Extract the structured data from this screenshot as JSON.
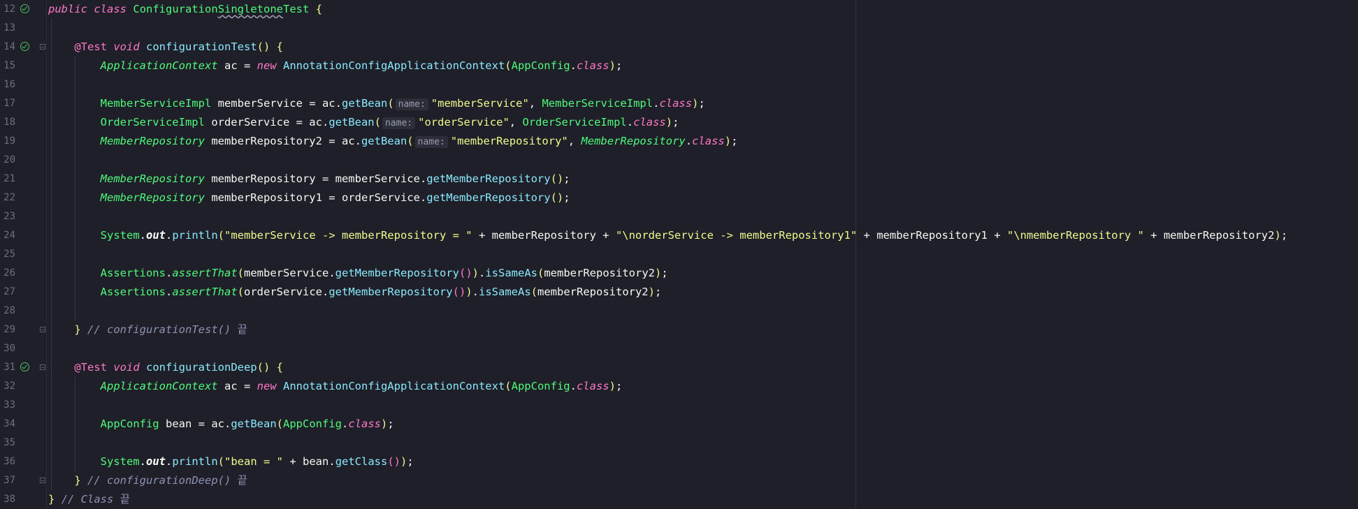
{
  "editor": {
    "lines": [
      {
        "n": "12",
        "run": true,
        "fold": false
      },
      {
        "n": "13",
        "run": false,
        "fold": false
      },
      {
        "n": "14",
        "run": true,
        "fold": true
      },
      {
        "n": "15",
        "run": false,
        "fold": false
      },
      {
        "n": "16",
        "run": false,
        "fold": false
      },
      {
        "n": "17",
        "run": false,
        "fold": false
      },
      {
        "n": "18",
        "run": false,
        "fold": false
      },
      {
        "n": "19",
        "run": false,
        "fold": false
      },
      {
        "n": "20",
        "run": false,
        "fold": false
      },
      {
        "n": "21",
        "run": false,
        "fold": false
      },
      {
        "n": "22",
        "run": false,
        "fold": false
      },
      {
        "n": "23",
        "run": false,
        "fold": false
      },
      {
        "n": "24",
        "run": false,
        "fold": false
      },
      {
        "n": "25",
        "run": false,
        "fold": false
      },
      {
        "n": "26",
        "run": false,
        "fold": false
      },
      {
        "n": "27",
        "run": false,
        "fold": false
      },
      {
        "n": "28",
        "run": false,
        "fold": false
      },
      {
        "n": "29",
        "run": false,
        "fold": true
      },
      {
        "n": "30",
        "run": false,
        "fold": false
      },
      {
        "n": "31",
        "run": true,
        "fold": true
      },
      {
        "n": "32",
        "run": false,
        "fold": false
      },
      {
        "n": "33",
        "run": false,
        "fold": false
      },
      {
        "n": "34",
        "run": false,
        "fold": false
      },
      {
        "n": "35",
        "run": false,
        "fold": false
      },
      {
        "n": "36",
        "run": false,
        "fold": false
      },
      {
        "n": "37",
        "run": false,
        "fold": true
      },
      {
        "n": "38",
        "run": false,
        "fold": false
      }
    ],
    "code": [
      {
        "tokens": [
          [
            "kw",
            "public"
          ],
          [
            "pun",
            " "
          ],
          [
            "kw",
            "class"
          ],
          [
            "pun",
            " "
          ],
          [
            "cls",
            "Configuration"
          ],
          [
            "cls under",
            "Singletone"
          ],
          [
            "cls",
            "Test"
          ],
          [
            "pun",
            " "
          ],
          [
            "par1",
            "{"
          ]
        ]
      },
      {
        "tokens": []
      },
      {
        "tokens": [
          [
            "pun",
            "    "
          ],
          [
            "ann",
            "@Test"
          ],
          [
            "pun",
            " "
          ],
          [
            "kw",
            "void"
          ],
          [
            "pun",
            " "
          ],
          [
            "mth",
            "configurationTest"
          ],
          [
            "par1",
            "()"
          ],
          [
            "pun",
            " "
          ],
          [
            "par1",
            "{"
          ]
        ]
      },
      {
        "tokens": [
          [
            "pun",
            "        "
          ],
          [
            "iface",
            "ApplicationContext"
          ],
          [
            "pun",
            " "
          ],
          [
            "var",
            "ac"
          ],
          [
            "pun",
            " = "
          ],
          [
            "kw",
            "new"
          ],
          [
            "pun",
            " "
          ],
          [
            "mth",
            "AnnotationConfigApplicationContext"
          ],
          [
            "par1",
            "("
          ],
          [
            "cls",
            "AppConfig"
          ],
          [
            "pun",
            "."
          ],
          [
            "kw",
            "class"
          ],
          [
            "par1",
            ")"
          ],
          [
            "pun",
            ";"
          ]
        ]
      },
      {
        "tokens": []
      },
      {
        "tokens": [
          [
            "pun",
            "        "
          ],
          [
            "cls",
            "MemberServiceImpl"
          ],
          [
            "pun",
            " "
          ],
          [
            "var",
            "memberService"
          ],
          [
            "pun",
            " = "
          ],
          [
            "var",
            "ac"
          ],
          [
            "pun",
            "."
          ],
          [
            "mth",
            "getBean"
          ],
          [
            "par1",
            "("
          ],
          [
            "hint",
            "name:"
          ],
          [
            "str",
            "\"memberService\""
          ],
          [
            "pun",
            ", "
          ],
          [
            "cls",
            "MemberServiceImpl"
          ],
          [
            "pun",
            "."
          ],
          [
            "kw",
            "class"
          ],
          [
            "par1",
            ")"
          ],
          [
            "pun",
            ";"
          ]
        ]
      },
      {
        "tokens": [
          [
            "pun",
            "        "
          ],
          [
            "cls",
            "OrderServiceImpl"
          ],
          [
            "pun",
            " "
          ],
          [
            "var",
            "orderService"
          ],
          [
            "pun",
            " = "
          ],
          [
            "var",
            "ac"
          ],
          [
            "pun",
            "."
          ],
          [
            "mth",
            "getBean"
          ],
          [
            "par1",
            "("
          ],
          [
            "hint",
            "name:"
          ],
          [
            "str",
            "\"orderService\""
          ],
          [
            "pun",
            ", "
          ],
          [
            "cls",
            "OrderServiceImpl"
          ],
          [
            "pun",
            "."
          ],
          [
            "kw",
            "class"
          ],
          [
            "par1",
            ")"
          ],
          [
            "pun",
            ";"
          ]
        ]
      },
      {
        "tokens": [
          [
            "pun",
            "        "
          ],
          [
            "iface",
            "MemberRepository"
          ],
          [
            "pun",
            " "
          ],
          [
            "var",
            "memberRepository2"
          ],
          [
            "pun",
            " = "
          ],
          [
            "var",
            "ac"
          ],
          [
            "pun",
            "."
          ],
          [
            "mth",
            "getBean"
          ],
          [
            "par1",
            "("
          ],
          [
            "hint",
            "name:"
          ],
          [
            "str",
            "\"memberRepository\""
          ],
          [
            "pun",
            ", "
          ],
          [
            "iface",
            "MemberRepository"
          ],
          [
            "pun",
            "."
          ],
          [
            "kw",
            "class"
          ],
          [
            "par1",
            ")"
          ],
          [
            "pun",
            ";"
          ]
        ]
      },
      {
        "tokens": []
      },
      {
        "tokens": [
          [
            "pun",
            "        "
          ],
          [
            "iface",
            "MemberRepository"
          ],
          [
            "pun",
            " "
          ],
          [
            "var",
            "memberRepository"
          ],
          [
            "pun",
            " = "
          ],
          [
            "var",
            "memberService"
          ],
          [
            "pun",
            "."
          ],
          [
            "mth",
            "getMemberRepository"
          ],
          [
            "par1",
            "()"
          ],
          [
            "pun",
            ";"
          ]
        ]
      },
      {
        "tokens": [
          [
            "pun",
            "        "
          ],
          [
            "iface",
            "MemberRepository"
          ],
          [
            "pun",
            " "
          ],
          [
            "var",
            "memberRepository1"
          ],
          [
            "pun",
            " = "
          ],
          [
            "var",
            "orderService"
          ],
          [
            "pun",
            "."
          ],
          [
            "mth",
            "getMemberRepository"
          ],
          [
            "par1",
            "()"
          ],
          [
            "pun",
            ";"
          ]
        ]
      },
      {
        "tokens": []
      },
      {
        "tokens": [
          [
            "pun",
            "        "
          ],
          [
            "cls",
            "System"
          ],
          [
            "pun",
            "."
          ],
          [
            "fld",
            "out"
          ],
          [
            "pun",
            "."
          ],
          [
            "mth",
            "println"
          ],
          [
            "par1",
            "("
          ],
          [
            "str",
            "\"memberService -> memberRepository = \""
          ],
          [
            "pun",
            " + "
          ],
          [
            "var",
            "memberRepository"
          ],
          [
            "pun",
            " + "
          ],
          [
            "str",
            "\"\\norderService -> memberRepository1\""
          ],
          [
            "pun",
            " + "
          ],
          [
            "var",
            "memberRepository1"
          ],
          [
            "pun",
            " + "
          ],
          [
            "str",
            "\"\\nmemberRepository \""
          ],
          [
            "pun",
            " + "
          ],
          [
            "var",
            "memberRepository2"
          ],
          [
            "par1",
            ")"
          ],
          [
            "pun",
            ";"
          ]
        ]
      },
      {
        "tokens": []
      },
      {
        "tokens": [
          [
            "pun",
            "        "
          ],
          [
            "cls",
            "Assertions"
          ],
          [
            "pun",
            "."
          ],
          [
            "stat",
            "assertThat"
          ],
          [
            "par1",
            "("
          ],
          [
            "var",
            "memberService"
          ],
          [
            "pun",
            "."
          ],
          [
            "mth",
            "getMemberRepository"
          ],
          [
            "par2",
            "()"
          ],
          [
            "par1",
            ")"
          ],
          [
            "pun",
            "."
          ],
          [
            "mth",
            "isSameAs"
          ],
          [
            "par1",
            "("
          ],
          [
            "var",
            "memberRepository2"
          ],
          [
            "par1",
            ")"
          ],
          [
            "pun",
            ";"
          ]
        ]
      },
      {
        "tokens": [
          [
            "pun",
            "        "
          ],
          [
            "cls",
            "Assertions"
          ],
          [
            "pun",
            "."
          ],
          [
            "stat",
            "assertThat"
          ],
          [
            "par1",
            "("
          ],
          [
            "var",
            "orderService"
          ],
          [
            "pun",
            "."
          ],
          [
            "mth",
            "getMemberRepository"
          ],
          [
            "par2",
            "()"
          ],
          [
            "par1",
            ")"
          ],
          [
            "pun",
            "."
          ],
          [
            "mth",
            "isSameAs"
          ],
          [
            "par1",
            "("
          ],
          [
            "var",
            "memberRepository2"
          ],
          [
            "par1",
            ")"
          ],
          [
            "pun",
            ";"
          ]
        ]
      },
      {
        "tokens": []
      },
      {
        "tokens": [
          [
            "pun",
            "    "
          ],
          [
            "par1",
            "}"
          ],
          [
            "pun",
            " "
          ],
          [
            "cmt",
            "// configurationTest() "
          ],
          [
            "kr",
            "끝"
          ]
        ]
      },
      {
        "tokens": []
      },
      {
        "tokens": [
          [
            "pun",
            "    "
          ],
          [
            "ann",
            "@Test"
          ],
          [
            "pun",
            " "
          ],
          [
            "kw",
            "void"
          ],
          [
            "pun",
            " "
          ],
          [
            "mth",
            "configurationDeep"
          ],
          [
            "par1",
            "()"
          ],
          [
            "pun",
            " "
          ],
          [
            "par1",
            "{"
          ]
        ]
      },
      {
        "tokens": [
          [
            "pun",
            "        "
          ],
          [
            "iface",
            "ApplicationContext"
          ],
          [
            "pun",
            " "
          ],
          [
            "var",
            "ac"
          ],
          [
            "pun",
            " = "
          ],
          [
            "kw",
            "new"
          ],
          [
            "pun",
            " "
          ],
          [
            "mth",
            "AnnotationConfigApplicationContext"
          ],
          [
            "par1",
            "("
          ],
          [
            "cls",
            "AppConfig"
          ],
          [
            "pun",
            "."
          ],
          [
            "kw",
            "class"
          ],
          [
            "par1",
            ")"
          ],
          [
            "pun",
            ";"
          ]
        ]
      },
      {
        "tokens": []
      },
      {
        "tokens": [
          [
            "pun",
            "        "
          ],
          [
            "cls",
            "AppConfig"
          ],
          [
            "pun",
            " "
          ],
          [
            "var",
            "bean"
          ],
          [
            "pun",
            " = "
          ],
          [
            "var",
            "ac"
          ],
          [
            "pun",
            "."
          ],
          [
            "mth",
            "getBean"
          ],
          [
            "par1",
            "("
          ],
          [
            "cls",
            "AppConfig"
          ],
          [
            "pun",
            "."
          ],
          [
            "kw",
            "class"
          ],
          [
            "par1",
            ")"
          ],
          [
            "pun",
            ";"
          ]
        ]
      },
      {
        "tokens": []
      },
      {
        "tokens": [
          [
            "pun",
            "        "
          ],
          [
            "cls",
            "System"
          ],
          [
            "pun",
            "."
          ],
          [
            "fld",
            "out"
          ],
          [
            "pun",
            "."
          ],
          [
            "mth",
            "println"
          ],
          [
            "par1",
            "("
          ],
          [
            "str",
            "\"bean = \""
          ],
          [
            "pun",
            " + "
          ],
          [
            "var",
            "bean"
          ],
          [
            "pun",
            "."
          ],
          [
            "mth",
            "getClass"
          ],
          [
            "par2",
            "()"
          ],
          [
            "par1",
            ")"
          ],
          [
            "pun",
            ";"
          ]
        ]
      },
      {
        "tokens": [
          [
            "pun",
            "    "
          ],
          [
            "par1",
            "}"
          ],
          [
            "pun",
            " "
          ],
          [
            "cmt",
            "// configurationDeep() "
          ],
          [
            "kr",
            "끝"
          ]
        ]
      },
      {
        "tokens": [
          [
            "par1",
            "}"
          ],
          [
            "pun",
            " "
          ],
          [
            "cmt",
            "// Class "
          ],
          [
            "kr",
            "끝"
          ]
        ]
      }
    ]
  }
}
